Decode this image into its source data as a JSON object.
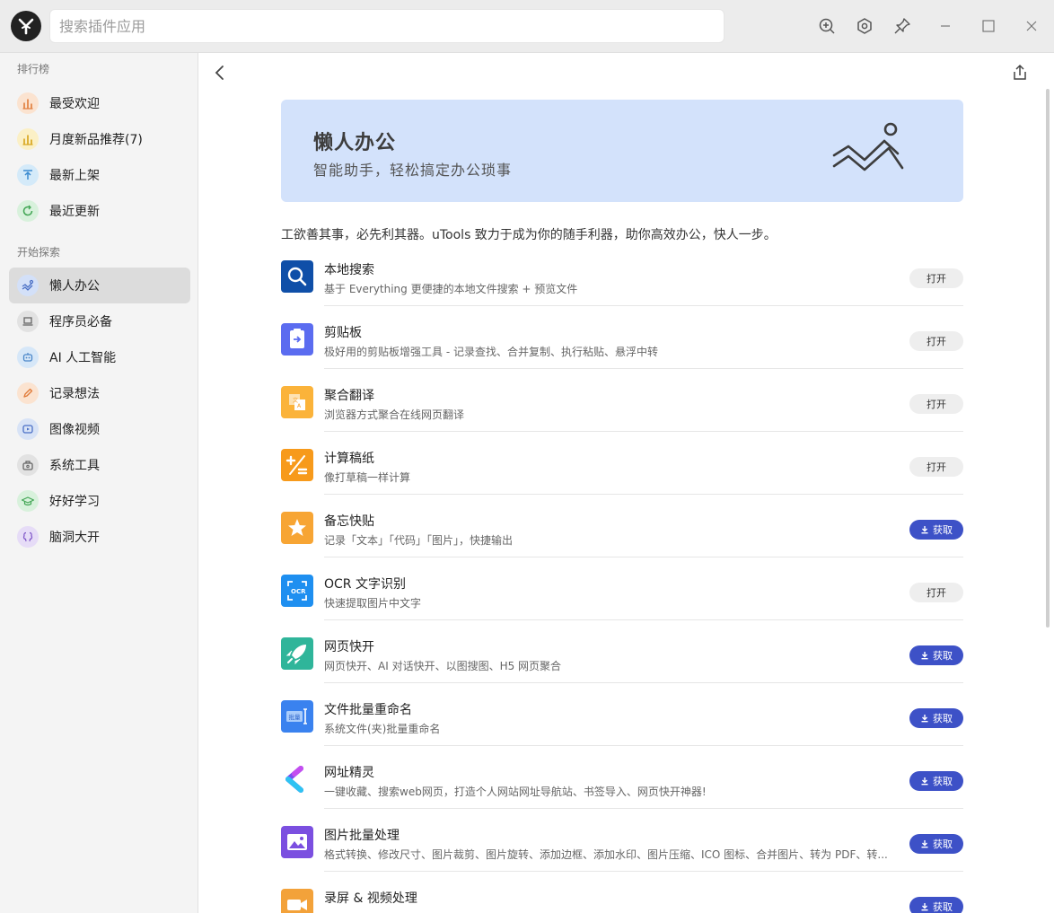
{
  "search": {
    "placeholder": "搜索插件应用"
  },
  "sidebar": {
    "sections": [
      {
        "title": "排行榜"
      },
      {
        "title": "开始探索"
      }
    ],
    "ranking": [
      {
        "label": "最受欢迎",
        "icon": "bar-chart-icon",
        "bg": "#fbe3d0",
        "fg": "#e07b39"
      },
      {
        "label": "月度新品推荐(7)",
        "icon": "bar-chart-icon",
        "bg": "#fbf0c6",
        "fg": "#d6a318"
      },
      {
        "label": "最新上架",
        "icon": "upload-icon",
        "bg": "#d4eaf9",
        "fg": "#3b8bd0"
      },
      {
        "label": "最近更新",
        "icon": "refresh-icon",
        "bg": "#d8f1dc",
        "fg": "#43a655"
      }
    ],
    "explore": [
      {
        "label": "懒人办公",
        "icon": "lounge-chair-icon",
        "bg": "#d3e0f8",
        "fg": "#4a6fc5",
        "active": true
      },
      {
        "label": "程序员必备",
        "icon": "laptop-icon",
        "bg": "#e2e2e2",
        "fg": "#666666"
      },
      {
        "label": "AI 人工智能",
        "icon": "robot-icon",
        "bg": "#d6e7f8",
        "fg": "#4a86c8"
      },
      {
        "label": "记录想法",
        "icon": "pencil-icon",
        "bg": "#fbe3d0",
        "fg": "#e07b39"
      },
      {
        "label": "图像视频",
        "icon": "play-icon",
        "bg": "#d8e3f6",
        "fg": "#4a6fc5"
      },
      {
        "label": "系统工具",
        "icon": "toolbox-icon",
        "bg": "#e2e2e2",
        "fg": "#666666"
      },
      {
        "label": "好好学习",
        "icon": "graduation-cap-icon",
        "bg": "#d8f1dc",
        "fg": "#43a655"
      },
      {
        "label": "脑洞大开",
        "icon": "brain-icon",
        "bg": "#e6dcf7",
        "fg": "#8058c8"
      }
    ]
  },
  "banner": {
    "title": "懒人办公",
    "subtitle": "智能助手，轻松搞定办公琐事",
    "icon": "lounge-chair-icon"
  },
  "intro": "工欲善其事，必先利其器。uTools 致力于成为你的随手利器，助你高效办公，快人一步。",
  "buttons": {
    "open": "打开",
    "get": "获取"
  },
  "plugins": [
    {
      "name": "本地搜索",
      "desc": "基于 Everything 更便捷的本地文件搜索 + 预览文件",
      "action": "open",
      "icon": "magnifier-icon",
      "color": "#0f4fa8"
    },
    {
      "name": "剪贴板",
      "desc": "极好用的剪贴板增强工具 - 记录查找、合并复制、执行粘贴、悬浮中转",
      "action": "open",
      "icon": "clipboard-icon",
      "color": "#5b6cf0"
    },
    {
      "name": "聚合翻译",
      "desc": "浏览器方式聚合在线网页翻译",
      "action": "open",
      "icon": "translate-icon",
      "color": "#fbb33a"
    },
    {
      "name": "计算稿纸",
      "desc": "像打草稿一样计算",
      "action": "open",
      "icon": "calculator-icon",
      "color": "#f79a1b"
    },
    {
      "name": "备忘快贴",
      "desc": "记录「文本」「代码」「图片」，快捷输出",
      "action": "get",
      "icon": "star-note-icon",
      "color": "#f7a534"
    },
    {
      "name": "OCR 文字识别",
      "desc": "快速提取图片中文字",
      "action": "open",
      "icon": "ocr-scan-icon",
      "color": "#1e8ff0"
    },
    {
      "name": "网页快开",
      "desc": "网页快开、AI 对话快开、以图搜图、H5 网页聚合",
      "action": "get",
      "icon": "rocket-icon",
      "color": "#2fb59a"
    },
    {
      "name": "文件批量重命名",
      "desc": "系统文件(夹)批量重命名",
      "action": "get",
      "icon": "rename-icon",
      "color": "#3a82ef"
    },
    {
      "name": "网址精灵",
      "desc": "一键收藏、搜索web网页，打造个人网站网址导航站、书签导入、网页快开神器!",
      "action": "get",
      "icon": "chevron-logo-icon",
      "color": "#ffffff"
    },
    {
      "name": "图片批量处理",
      "desc": "格式转换、修改尺寸、图片裁剪、图片旋转、添加边框、添加水印、图片压缩、ICO 图标、合并图片、转为 PDF、转...",
      "action": "get",
      "icon": "image-icon",
      "color": "#7b4fe0"
    },
    {
      "name": "录屏 & 视频处理",
      "desc": "",
      "action": "get",
      "icon": "video-camera-icon",
      "color": "#f3a23a"
    }
  ]
}
